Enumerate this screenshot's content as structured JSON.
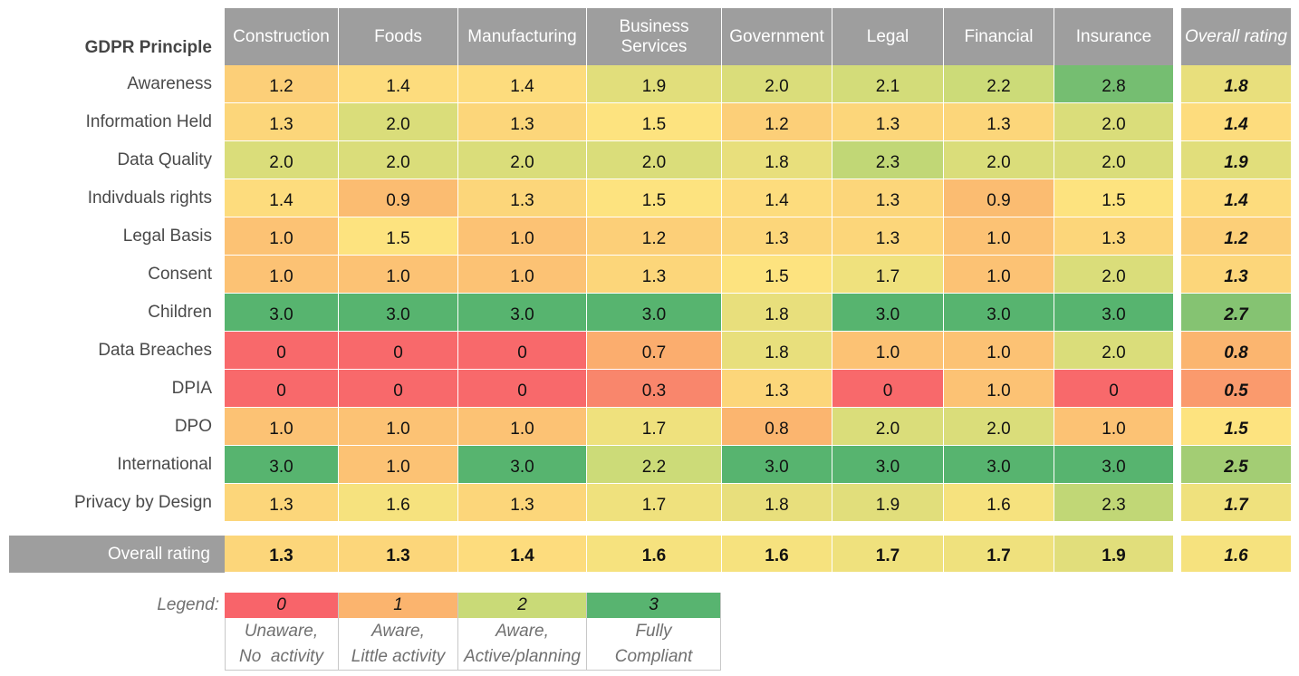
{
  "chart_data": {
    "type": "heatmap",
    "title": "",
    "row_header": "GDPR Principle",
    "columns": [
      "Construction",
      "Foods",
      "Manufacturing",
      "Business Services",
      "Government",
      "Legal",
      "Financial",
      "Insurance"
    ],
    "overall_column_label": "Overall rating",
    "rows": [
      {
        "label": "Awareness",
        "values": [
          "1.2",
          "1.4",
          "1.4",
          "1.9",
          "2.0",
          "2.1",
          "2.2",
          "2.8"
        ],
        "overall": "1.8"
      },
      {
        "label": "Information Held",
        "values": [
          "1.3",
          "2.0",
          "1.3",
          "1.5",
          "1.2",
          "1.3",
          "1.3",
          "2.0"
        ],
        "overall": "1.4"
      },
      {
        "label": "Data Quality",
        "values": [
          "2.0",
          "2.0",
          "2.0",
          "2.0",
          "1.8",
          "2.3",
          "2.0",
          "2.0"
        ],
        "overall": "1.9"
      },
      {
        "label": "Indivduals rights",
        "values": [
          "1.4",
          "0.9",
          "1.3",
          "1.5",
          "1.4",
          "1.3",
          "0.9",
          "1.5"
        ],
        "overall": "1.4"
      },
      {
        "label": "Legal Basis",
        "values": [
          "1.0",
          "1.5",
          "1.0",
          "1.2",
          "1.3",
          "1.3",
          "1.0",
          "1.3"
        ],
        "overall": "1.2"
      },
      {
        "label": "Consent",
        "values": [
          "1.0",
          "1.0",
          "1.0",
          "1.3",
          "1.5",
          "1.7",
          "1.0",
          "2.0"
        ],
        "overall": "1.3"
      },
      {
        "label": "Children",
        "values": [
          "3.0",
          "3.0",
          "3.0",
          "3.0",
          "1.8",
          "3.0",
          "3.0",
          "3.0"
        ],
        "overall": "2.7"
      },
      {
        "label": "Data Breaches",
        "values": [
          "0",
          "0",
          "0",
          "0.7",
          "1.8",
          "1.0",
          "1.0",
          "2.0"
        ],
        "overall": "0.8"
      },
      {
        "label": "DPIA",
        "values": [
          "0",
          "0",
          "0",
          "0.3",
          "1.3",
          "0",
          "1.0",
          "0"
        ],
        "overall": "0.5"
      },
      {
        "label": "DPO",
        "values": [
          "1.0",
          "1.0",
          "1.0",
          "1.7",
          "0.8",
          "2.0",
          "2.0",
          "1.0"
        ],
        "overall": "1.5"
      },
      {
        "label": "International",
        "values": [
          "3.0",
          "1.0",
          "3.0",
          "2.2",
          "3.0",
          "3.0",
          "3.0",
          "3.0"
        ],
        "overall": "2.5"
      },
      {
        "label": "Privacy by Design",
        "values": [
          "1.3",
          "1.6",
          "1.3",
          "1.7",
          "1.8",
          "1.9",
          "1.6",
          "2.3"
        ],
        "overall": "1.7"
      }
    ],
    "overall_row": {
      "label": "Overall rating",
      "values": [
        "1.3",
        "1.3",
        "1.4",
        "1.6",
        "1.6",
        "1.7",
        "1.7",
        "1.9"
      ],
      "overall": "1.6"
    },
    "scale": {
      "min": 0,
      "max": 3
    },
    "color_stops": [
      "#f8696b",
      "#fbb26e",
      "#fde37f",
      "#c9da77",
      "#57b46f"
    ],
    "legend": {
      "label": "Legend:",
      "items": [
        {
          "value": "0",
          "color": "#f8646a",
          "line1": "Unaware,",
          "line2": "No  activity"
        },
        {
          "value": "1",
          "color": "#fbb46e",
          "line1": "Aware,",
          "line2": "Little activity"
        },
        {
          "value": "2",
          "color": "#c9da77",
          "line1": "Aware,",
          "line2": "Active/planning"
        },
        {
          "value": "3",
          "color": "#58b470",
          "line1": "Fully",
          "line2": "Compliant"
        }
      ]
    }
  }
}
